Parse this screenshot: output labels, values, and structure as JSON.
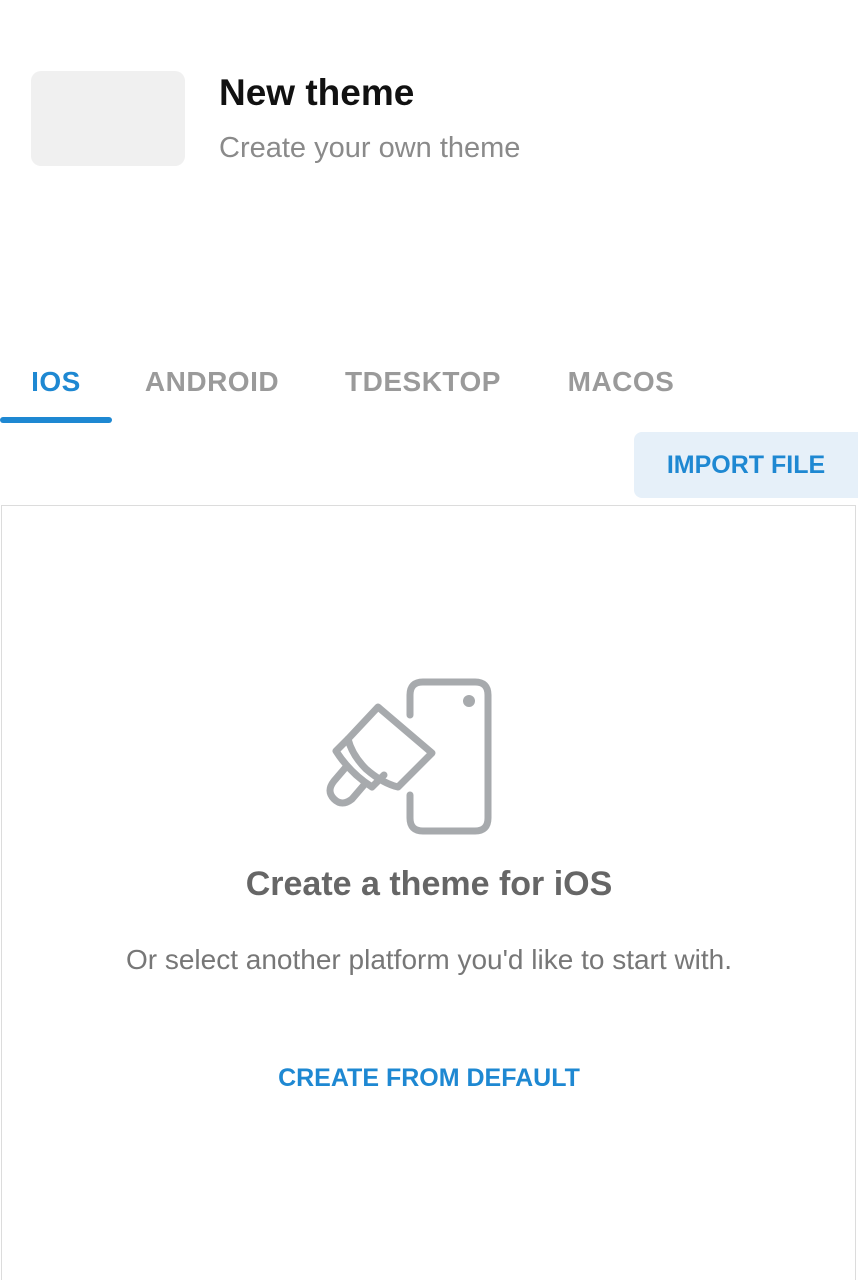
{
  "header": {
    "title": "New theme",
    "subtitle": "Create your own theme"
  },
  "tabs": [
    {
      "label": "IOS",
      "active": true
    },
    {
      "label": "ANDROID",
      "active": false
    },
    {
      "label": "TDESKTOP",
      "active": false
    },
    {
      "label": "MACOS",
      "active": false
    }
  ],
  "toolbar": {
    "import_label": "IMPORT FILE"
  },
  "empty_state": {
    "icon": "paint-brush-phone-icon",
    "title": "Create a theme for iOS",
    "description": "Or select another platform you'd like to start with.",
    "create_label": "CREATE FROM DEFAULT"
  },
  "colors": {
    "accent": "#1e88d2",
    "tab_inactive": "#9a9a9a",
    "import_bg": "#e6f0f9"
  }
}
